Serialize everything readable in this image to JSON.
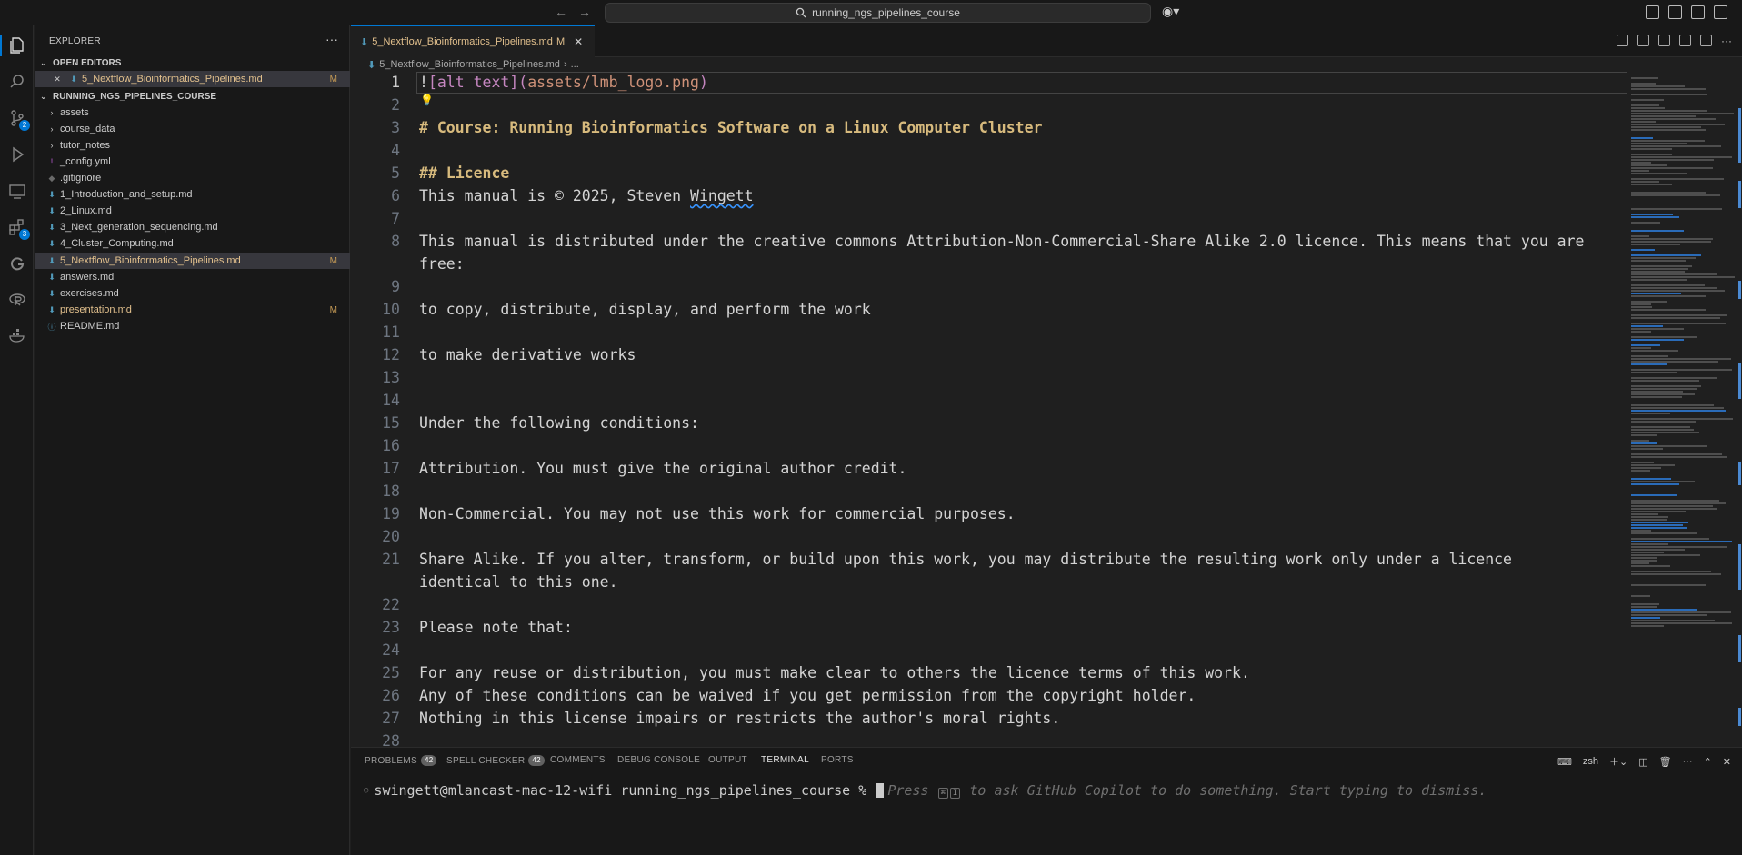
{
  "window": {
    "search_text": "running_ngs_pipelines_course"
  },
  "activity_bar": {
    "scm_badge": "2",
    "extensions_badge": "3"
  },
  "sidebar": {
    "title": "EXPLORER",
    "open_editors": {
      "header": "OPEN EDITORS",
      "items": [
        {
          "label": "5_Nextflow_Bioinformatics_Pipelines.md",
          "status": "M"
        }
      ]
    },
    "project": {
      "header": "RUNNING_NGS_PIPELINES_COURSE",
      "items": [
        {
          "label": "assets",
          "type": "folder"
        },
        {
          "label": "course_data",
          "type": "folder"
        },
        {
          "label": "tutor_notes",
          "type": "folder"
        },
        {
          "label": "_config.yml",
          "type": "yml"
        },
        {
          "label": ".gitignore",
          "type": "git"
        },
        {
          "label": "1_Introduction_and_setup.md",
          "type": "md"
        },
        {
          "label": "2_Linux.md",
          "type": "md"
        },
        {
          "label": "3_Next_generation_sequencing.md",
          "type": "md"
        },
        {
          "label": "4_Cluster_Computing.md",
          "type": "md"
        },
        {
          "label": "5_Nextflow_Bioinformatics_Pipelines.md",
          "type": "md",
          "status": "M",
          "selected": true
        },
        {
          "label": "answers.md",
          "type": "md"
        },
        {
          "label": "exercises.md",
          "type": "md"
        },
        {
          "label": "presentation.md",
          "type": "md",
          "status": "M"
        },
        {
          "label": "README.md",
          "type": "info"
        }
      ]
    }
  },
  "tab": {
    "label": "5_Nextflow_Bioinformatics_Pipelines.md",
    "status": "M"
  },
  "breadcrumb": {
    "file": "5_Nextflow_Bioinformatics_Pipelines.md",
    "more": "..."
  },
  "editor": {
    "lines": [
      {
        "n": "1",
        "text": ""
      },
      {
        "n": "2",
        "text": ""
      },
      {
        "n": "3",
        "text": "# Course: Running Bioinformatics Software on a Linux Computer Cluster"
      },
      {
        "n": "",
        "text": ""
      },
      {
        "n": "5",
        "text": "## Licence"
      },
      {
        "n": "6",
        "text": ""
      },
      {
        "n": "7",
        "text": ""
      },
      {
        "n": "8",
        "text": "This manual is distributed under the creative commons Attribution-Non-Commercial-Share Alike 2.0 licence. This means that you are"
      },
      {
        "n": "",
        "text": "free:"
      },
      {
        "n": "10",
        "text": ""
      },
      {
        "n": "11",
        "text": ""
      },
      {
        "n": "12",
        "text": "to make derivative works"
      },
      {
        "n": "13",
        "text": ""
      },
      {
        "n": "14",
        "text": ""
      },
      {
        "n": "15",
        "text": "Under the following conditions:"
      },
      {
        "n": "16",
        "text": ""
      },
      {
        "n": "17",
        "text": "Attribution. You must give the original author credit."
      },
      {
        "n": "18",
        "text": ""
      },
      {
        "n": "19",
        "text": "Non-Commercial. You may not use this work for commercial purposes."
      },
      {
        "n": "20",
        "text": ""
      },
      {
        "n": "21",
        "text": "Share Alike. If you alter, transform, or build upon this work, you may distribute the resulting work only under a licence"
      },
      {
        "n": "",
        "text": "identical to this one."
      },
      {
        "n": "22",
        "text": ""
      },
      {
        "n": "23",
        "text": "Please note that:"
      },
      {
        "n": "24",
        "text": ""
      },
      {
        "n": "25",
        "text": "For any reuse or distribution, you must make clear to others the licence terms of this work."
      },
      {
        "n": "26",
        "text": "Any of these conditions can be waived if you get permission from the copyright holder."
      },
      {
        "n": "27",
        "text": "Nothing in this license impairs or restricts the author's moral rights."
      },
      {
        "n": "28",
        "text": ""
      }
    ],
    "line1": {
      "bang": "!",
      "open": "[",
      "alt": "alt text",
      "mid": "](",
      "url": "assets/lmb_logo.png",
      "close": ")"
    },
    "line4_n": "4",
    "line6": {
      "pre": "This manual is © 2025, Steven ",
      "name": "Wingett"
    },
    "line9_n": "9",
    "line10": {
      "text": "to copy, distribute, display, and perform the work"
    }
  },
  "panel": {
    "tabs": [
      {
        "label": "PROBLEMS",
        "badge": "42"
      },
      {
        "label": "SPELL CHECKER",
        "badge": "42"
      },
      {
        "label": "COMMENTS"
      },
      {
        "label": "DEBUG CONSOLE"
      },
      {
        "label": "OUTPUT"
      },
      {
        "label": "TERMINAL",
        "active": true
      },
      {
        "label": "PORTS"
      }
    ],
    "shell": "zsh",
    "prompt": "swingett@mlancast-mac-12-wifi running_ngs_pipelines_course % ",
    "ghost_pre": "Press ",
    "ghost_key1": "⌘",
    "ghost_key2": "I",
    "ghost_post": " to ask GitHub Copilot to do something. Start typing to dismiss."
  }
}
